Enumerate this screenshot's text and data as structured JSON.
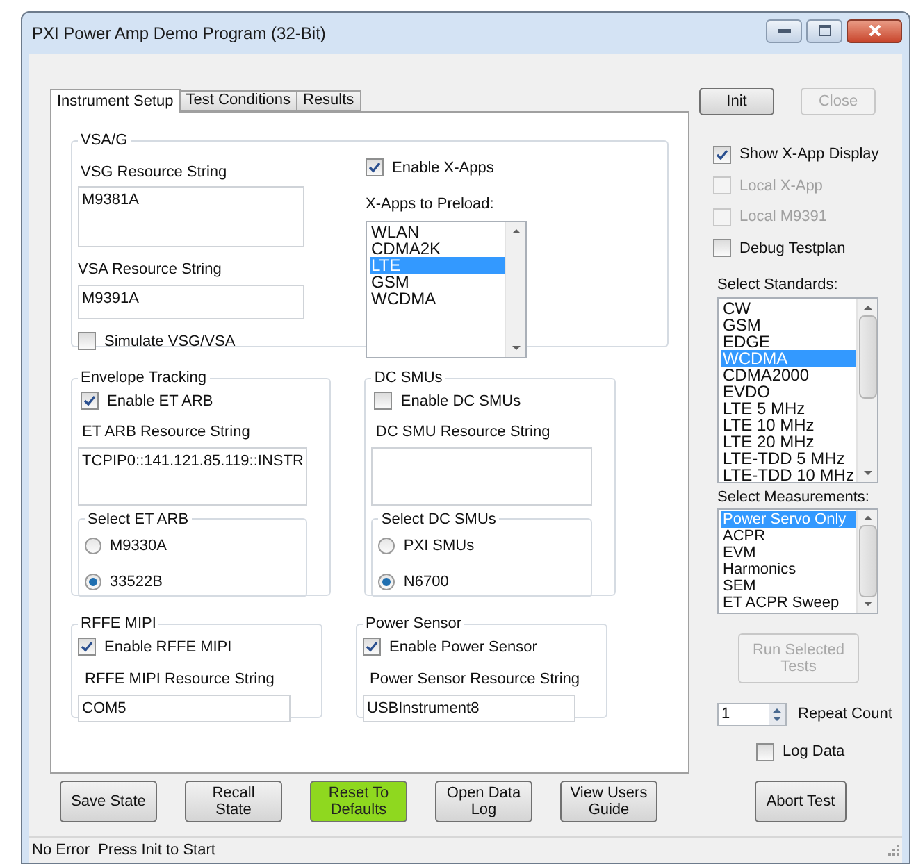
{
  "window": {
    "title": "PXI Power Amp Demo Program (32-Bit)"
  },
  "tabs": [
    {
      "label": "Instrument Setup",
      "selected": true
    },
    {
      "label": "Test Conditions",
      "selected": false
    },
    {
      "label": "Results",
      "selected": false
    }
  ],
  "vsag": {
    "title": "VSA/G",
    "vsg_label": "VSG Resource String",
    "vsg_value": "M9381A",
    "vsa_label": "VSA Resource String",
    "vsa_value": "M9391A",
    "simulate": {
      "label": "Simulate VSG/VSA",
      "checked": false
    },
    "enable_xapps": {
      "label": "Enable X-Apps",
      "checked": true
    },
    "xapps_label": "X-Apps to Preload:",
    "xapps": [
      {
        "label": "WLAN",
        "selected": false
      },
      {
        "label": "CDMA2K",
        "selected": false
      },
      {
        "label": "LTE",
        "selected": true
      },
      {
        "label": "GSM",
        "selected": false
      },
      {
        "label": "WCDMA",
        "selected": false
      }
    ]
  },
  "envelope_tracking": {
    "title": "Envelope Tracking",
    "enable": {
      "label": "Enable ET ARB",
      "checked": true
    },
    "resource_label": "ET ARB Resource String",
    "resource_value": "TCPIP0::141.121.85.119::INSTR",
    "select_title": "Select ET ARB",
    "options": [
      {
        "label": "M9330A",
        "selected": false
      },
      {
        "label": "33522B",
        "selected": true
      }
    ]
  },
  "dc_smus": {
    "title": "DC SMUs",
    "enable": {
      "label": "Enable DC SMUs",
      "checked": false
    },
    "resource_label": "DC SMU Resource String",
    "select_title": "Select DC SMUs",
    "options": [
      {
        "label": "PXI SMUs",
        "selected": false
      },
      {
        "label": "N6700",
        "selected": true
      }
    ]
  },
  "rffe_mipi": {
    "title": "RFFE MIPI",
    "enable": {
      "label": "Enable RFFE MIPI",
      "checked": true
    },
    "resource_label": "RFFE MIPI Resource String",
    "resource_value": "COM5"
  },
  "power_sensor": {
    "title": "Power Sensor",
    "enable": {
      "label": "Enable Power Sensor",
      "checked": true
    },
    "resource_label": "Power Sensor Resource String",
    "resource_value": "USBInstrument8"
  },
  "right_panel": {
    "buttons": [
      {
        "label": "Init",
        "disabled": false
      },
      {
        "label": "Close",
        "disabled": true
      }
    ],
    "options": [
      {
        "label": "Show X-App Display",
        "checked": true,
        "disabled": false
      },
      {
        "label": "Local X-App",
        "checked": false,
        "disabled": true
      },
      {
        "label": "Local M9391",
        "checked": false,
        "disabled": true
      },
      {
        "label": "Debug Testplan",
        "checked": false,
        "disabled": false
      }
    ],
    "standards_label": "Select Standards:",
    "standards": [
      {
        "label": "CW",
        "selected": false
      },
      {
        "label": "GSM",
        "selected": false
      },
      {
        "label": "EDGE",
        "selected": false
      },
      {
        "label": "WCDMA",
        "selected": true
      },
      {
        "label": "CDMA2000",
        "selected": false
      },
      {
        "label": "EVDO",
        "selected": false
      },
      {
        "label": "LTE 5 MHz",
        "selected": false
      },
      {
        "label": "LTE 10 MHz",
        "selected": false
      },
      {
        "label": "LTE 20 MHz",
        "selected": false
      },
      {
        "label": "LTE-TDD 5 MHz",
        "selected": false
      },
      {
        "label": "LTE-TDD 10 MHz",
        "selected": false
      }
    ],
    "measurements_label": "Select Measurements:",
    "measurements": [
      {
        "label": "Power Servo Only",
        "selected": true
      },
      {
        "label": "ACPR",
        "selected": false
      },
      {
        "label": "EVM",
        "selected": false
      },
      {
        "label": "Harmonics",
        "selected": false
      },
      {
        "label": "SEM",
        "selected": false
      },
      {
        "label": "ET ACPR Sweep",
        "selected": false
      }
    ],
    "run_button": {
      "label": "Run Selected Tests",
      "disabled": true
    },
    "repeat_count": {
      "value": "1",
      "label": "Repeat Count"
    },
    "log_data": {
      "label": "Log Data",
      "checked": false
    }
  },
  "bottom_buttons": [
    {
      "label": "Save State",
      "highlighted": false
    },
    {
      "label": "Recall State",
      "highlighted": false
    },
    {
      "label": "Reset To Defaults",
      "highlighted": true
    },
    {
      "label": "Open Data Log",
      "highlighted": false
    },
    {
      "label": "View Users Guide",
      "highlighted": false
    }
  ],
  "abort_button": {
    "label": "Abort Test"
  },
  "status_bar": [
    "No Error",
    "Press Init to Start"
  ]
}
